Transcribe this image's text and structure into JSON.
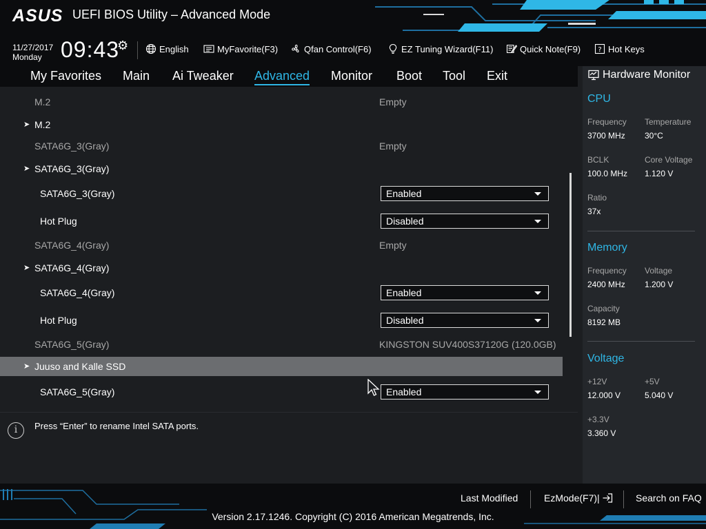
{
  "header": {
    "brand": "ASUS",
    "title": "UEFI BIOS Utility – Advanced Mode"
  },
  "toolbar": {
    "date": "11/27/2017",
    "day": "Monday",
    "time": "09:43",
    "language": "English",
    "myfavorite": "MyFavorite(F3)",
    "qfan": "Qfan Control(F6)",
    "ez_tuning": "EZ Tuning Wizard(F11)",
    "quick_note": "Quick Note(F9)",
    "hot_keys": "Hot Keys"
  },
  "tabs": [
    "My Favorites",
    "Main",
    "Ai Tweaker",
    "Advanced",
    "Monitor",
    "Boot",
    "Tool",
    "Exit"
  ],
  "active_tab": "Advanced",
  "rows": [
    {
      "kind": "info",
      "label": "M.2",
      "value": "Empty"
    },
    {
      "kind": "sub",
      "label": "M.2"
    },
    {
      "kind": "info",
      "label": "SATA6G_3(Gray)",
      "value": "Empty"
    },
    {
      "kind": "sub",
      "label": "SATA6G_3(Gray)"
    },
    {
      "kind": "opt",
      "label": "SATA6G_3(Gray)",
      "value": "Enabled"
    },
    {
      "kind": "opt",
      "label": "Hot Plug",
      "value": "Disabled"
    },
    {
      "kind": "info",
      "label": "SATA6G_4(Gray)",
      "value": "Empty"
    },
    {
      "kind": "sub",
      "label": "SATA6G_4(Gray)"
    },
    {
      "kind": "opt",
      "label": "SATA6G_4(Gray)",
      "value": "Enabled"
    },
    {
      "kind": "opt",
      "label": "Hot Plug",
      "value": "Disabled"
    },
    {
      "kind": "info",
      "label": "SATA6G_5(Gray)",
      "value": "KINGSTON SUV400S37120G (120.0GB)"
    },
    {
      "kind": "sub",
      "label": "Juuso and Kalle SSD",
      "highlighted": true
    },
    {
      "kind": "opt",
      "label": "SATA6G_5(Gray)",
      "value": "Enabled"
    }
  ],
  "help": {
    "text": "Press “Enter” to rename Intel SATA ports."
  },
  "hardware_monitor": {
    "title": "Hardware Monitor",
    "cpu": {
      "heading": "CPU",
      "frequency_label": "Frequency",
      "frequency": "3700 MHz",
      "temperature_label": "Temperature",
      "temperature": "30°C",
      "bclk_label": "BCLK",
      "bclk": "100.0 MHz",
      "core_voltage_label": "Core Voltage",
      "core_voltage": "1.120 V",
      "ratio_label": "Ratio",
      "ratio": "37x"
    },
    "memory": {
      "heading": "Memory",
      "frequency_label": "Frequency",
      "frequency": "2400 MHz",
      "voltage_label": "Voltage",
      "voltage": "1.200 V",
      "capacity_label": "Capacity",
      "capacity": "8192 MB"
    },
    "voltage": {
      "heading": "Voltage",
      "v12_label": "+12V",
      "v12": "12.000 V",
      "v5_label": "+5V",
      "v5": "5.040 V",
      "v33_label": "+3.3V",
      "v33": "3.360 V"
    }
  },
  "footer": {
    "last_modified": "Last Modified",
    "ezmode": "EzMode(F7)|",
    "search_faq": "Search on FAQ",
    "version": "Version 2.17.1246. Copyright (C) 2016 American Megatrends, Inc."
  },
  "colors": {
    "accent": "#2fb7e6",
    "background": "#1c1e21",
    "panel": "#24272b",
    "highlight_row": "#6b6d70"
  }
}
